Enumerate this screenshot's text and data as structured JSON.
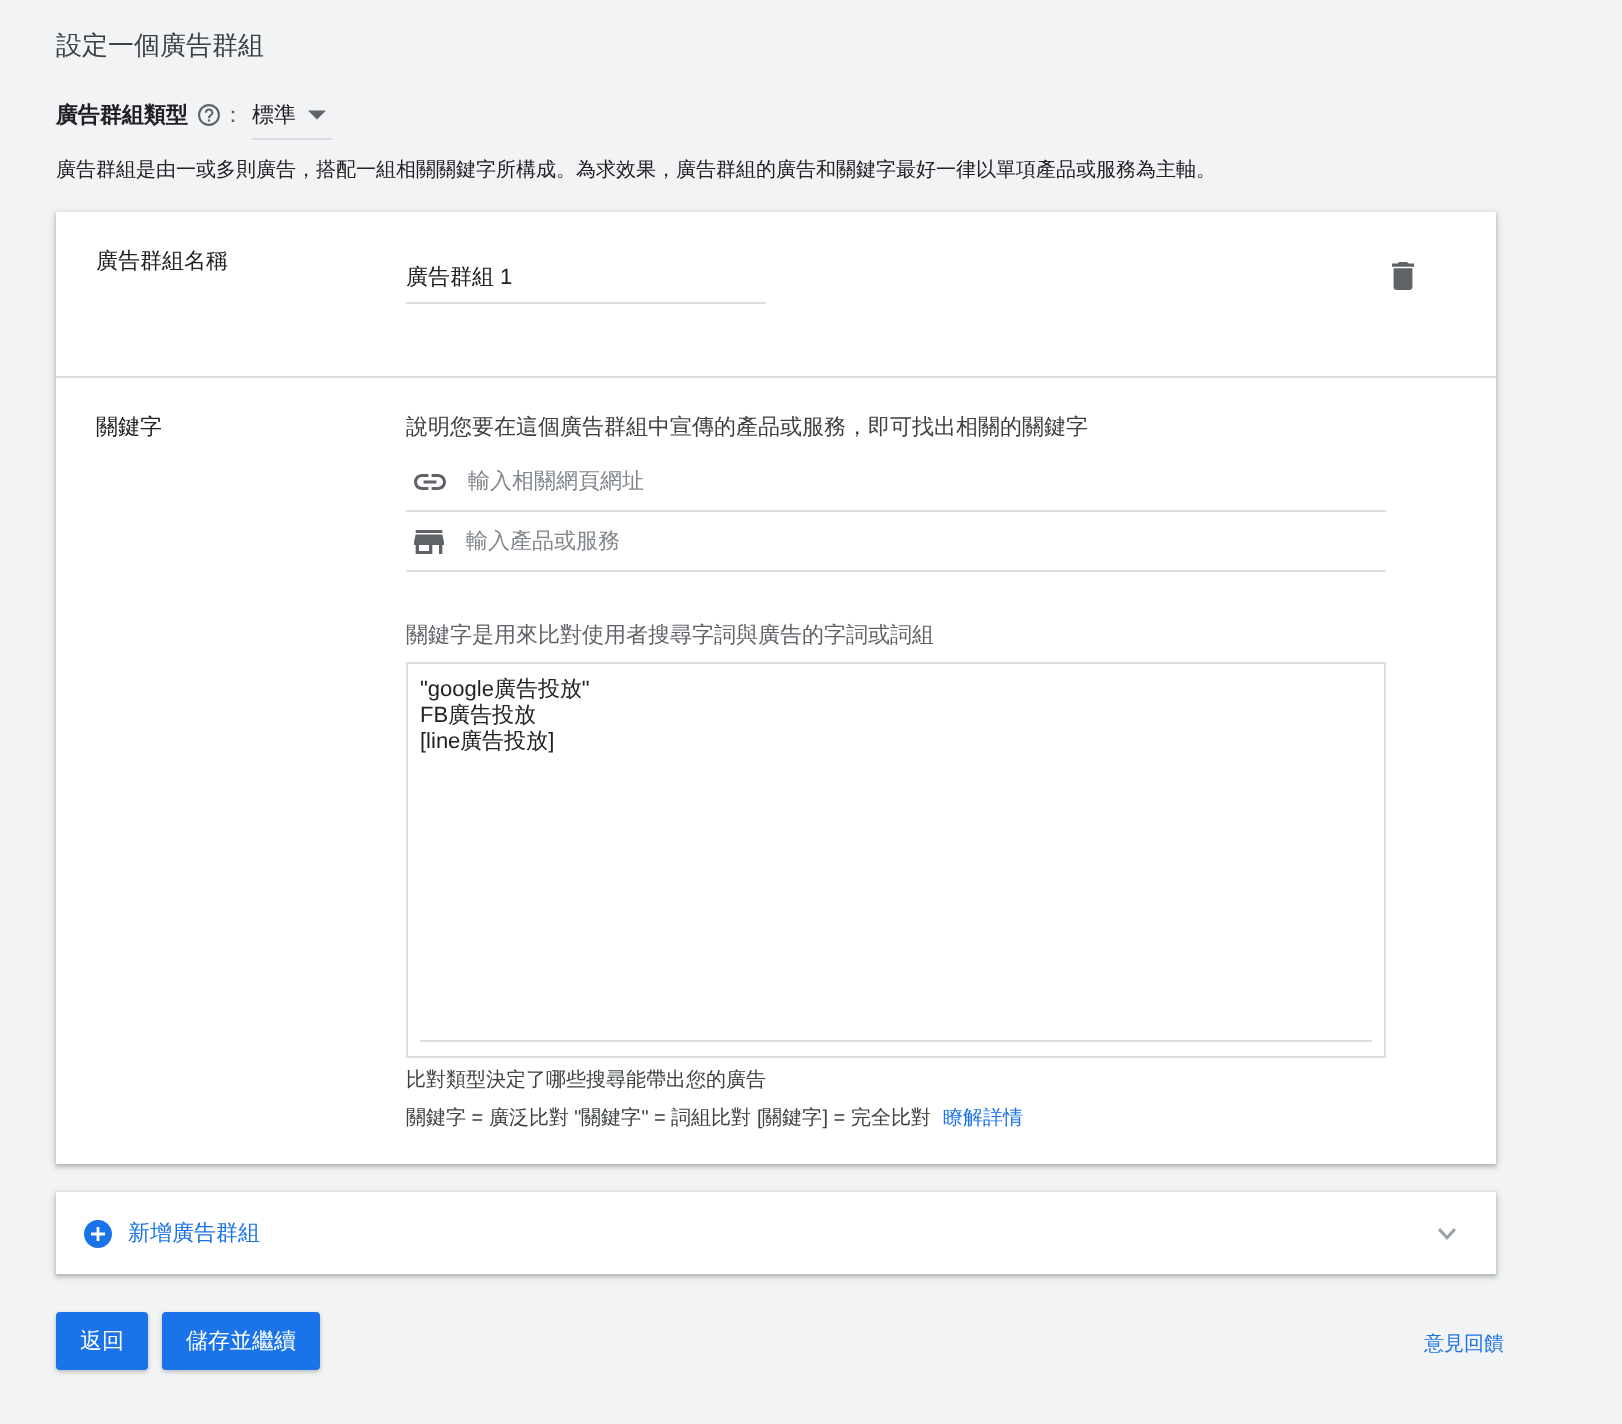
{
  "page_title": "設定一個廣告群組",
  "ad_group_type": {
    "label": "廣告群組類型",
    "separator": "：",
    "value": "標準"
  },
  "description": "廣告群組是由一或多則廣告，搭配一組相關關鍵字所構成。為求效果，廣告群組的廣告和關鍵字最好一律以單項產品或服務為主軸。",
  "ad_group_card": {
    "name_label": "廣告群組名稱",
    "name_value": "廣告群組 1",
    "keywords_label": "關鍵字",
    "keywords_hint": "說明您要在這個廣告群組中宣傳的產品或服務，即可找出相關的關鍵字",
    "inputs": [
      {
        "kind": "url",
        "placeholder": "輸入相關網頁網址"
      },
      {
        "kind": "product",
        "placeholder": "輸入產品或服務"
      }
    ],
    "keywords_field_label": "關鍵字是用來比對使用者搜尋字詞與廣告的字詞或詞組",
    "keywords": [
      "\"google廣告投放\"",
      "FB廣告投放",
      "[line廣告投放]"
    ],
    "match_note": "比對類型決定了哪些搜尋能帶出您的廣告",
    "match_legend": "關鍵字 = 廣泛比對 \"關鍵字\" = 詞組比對 [關鍵字] = 完全比對",
    "learn_more": "瞭解詳情"
  },
  "add_group": {
    "label": "新增廣告群組",
    "expanded": false
  },
  "buttons": [
    {
      "label": "返回"
    },
    {
      "label": "儲存並繼續"
    }
  ],
  "feedback_link": "意見回饋"
}
